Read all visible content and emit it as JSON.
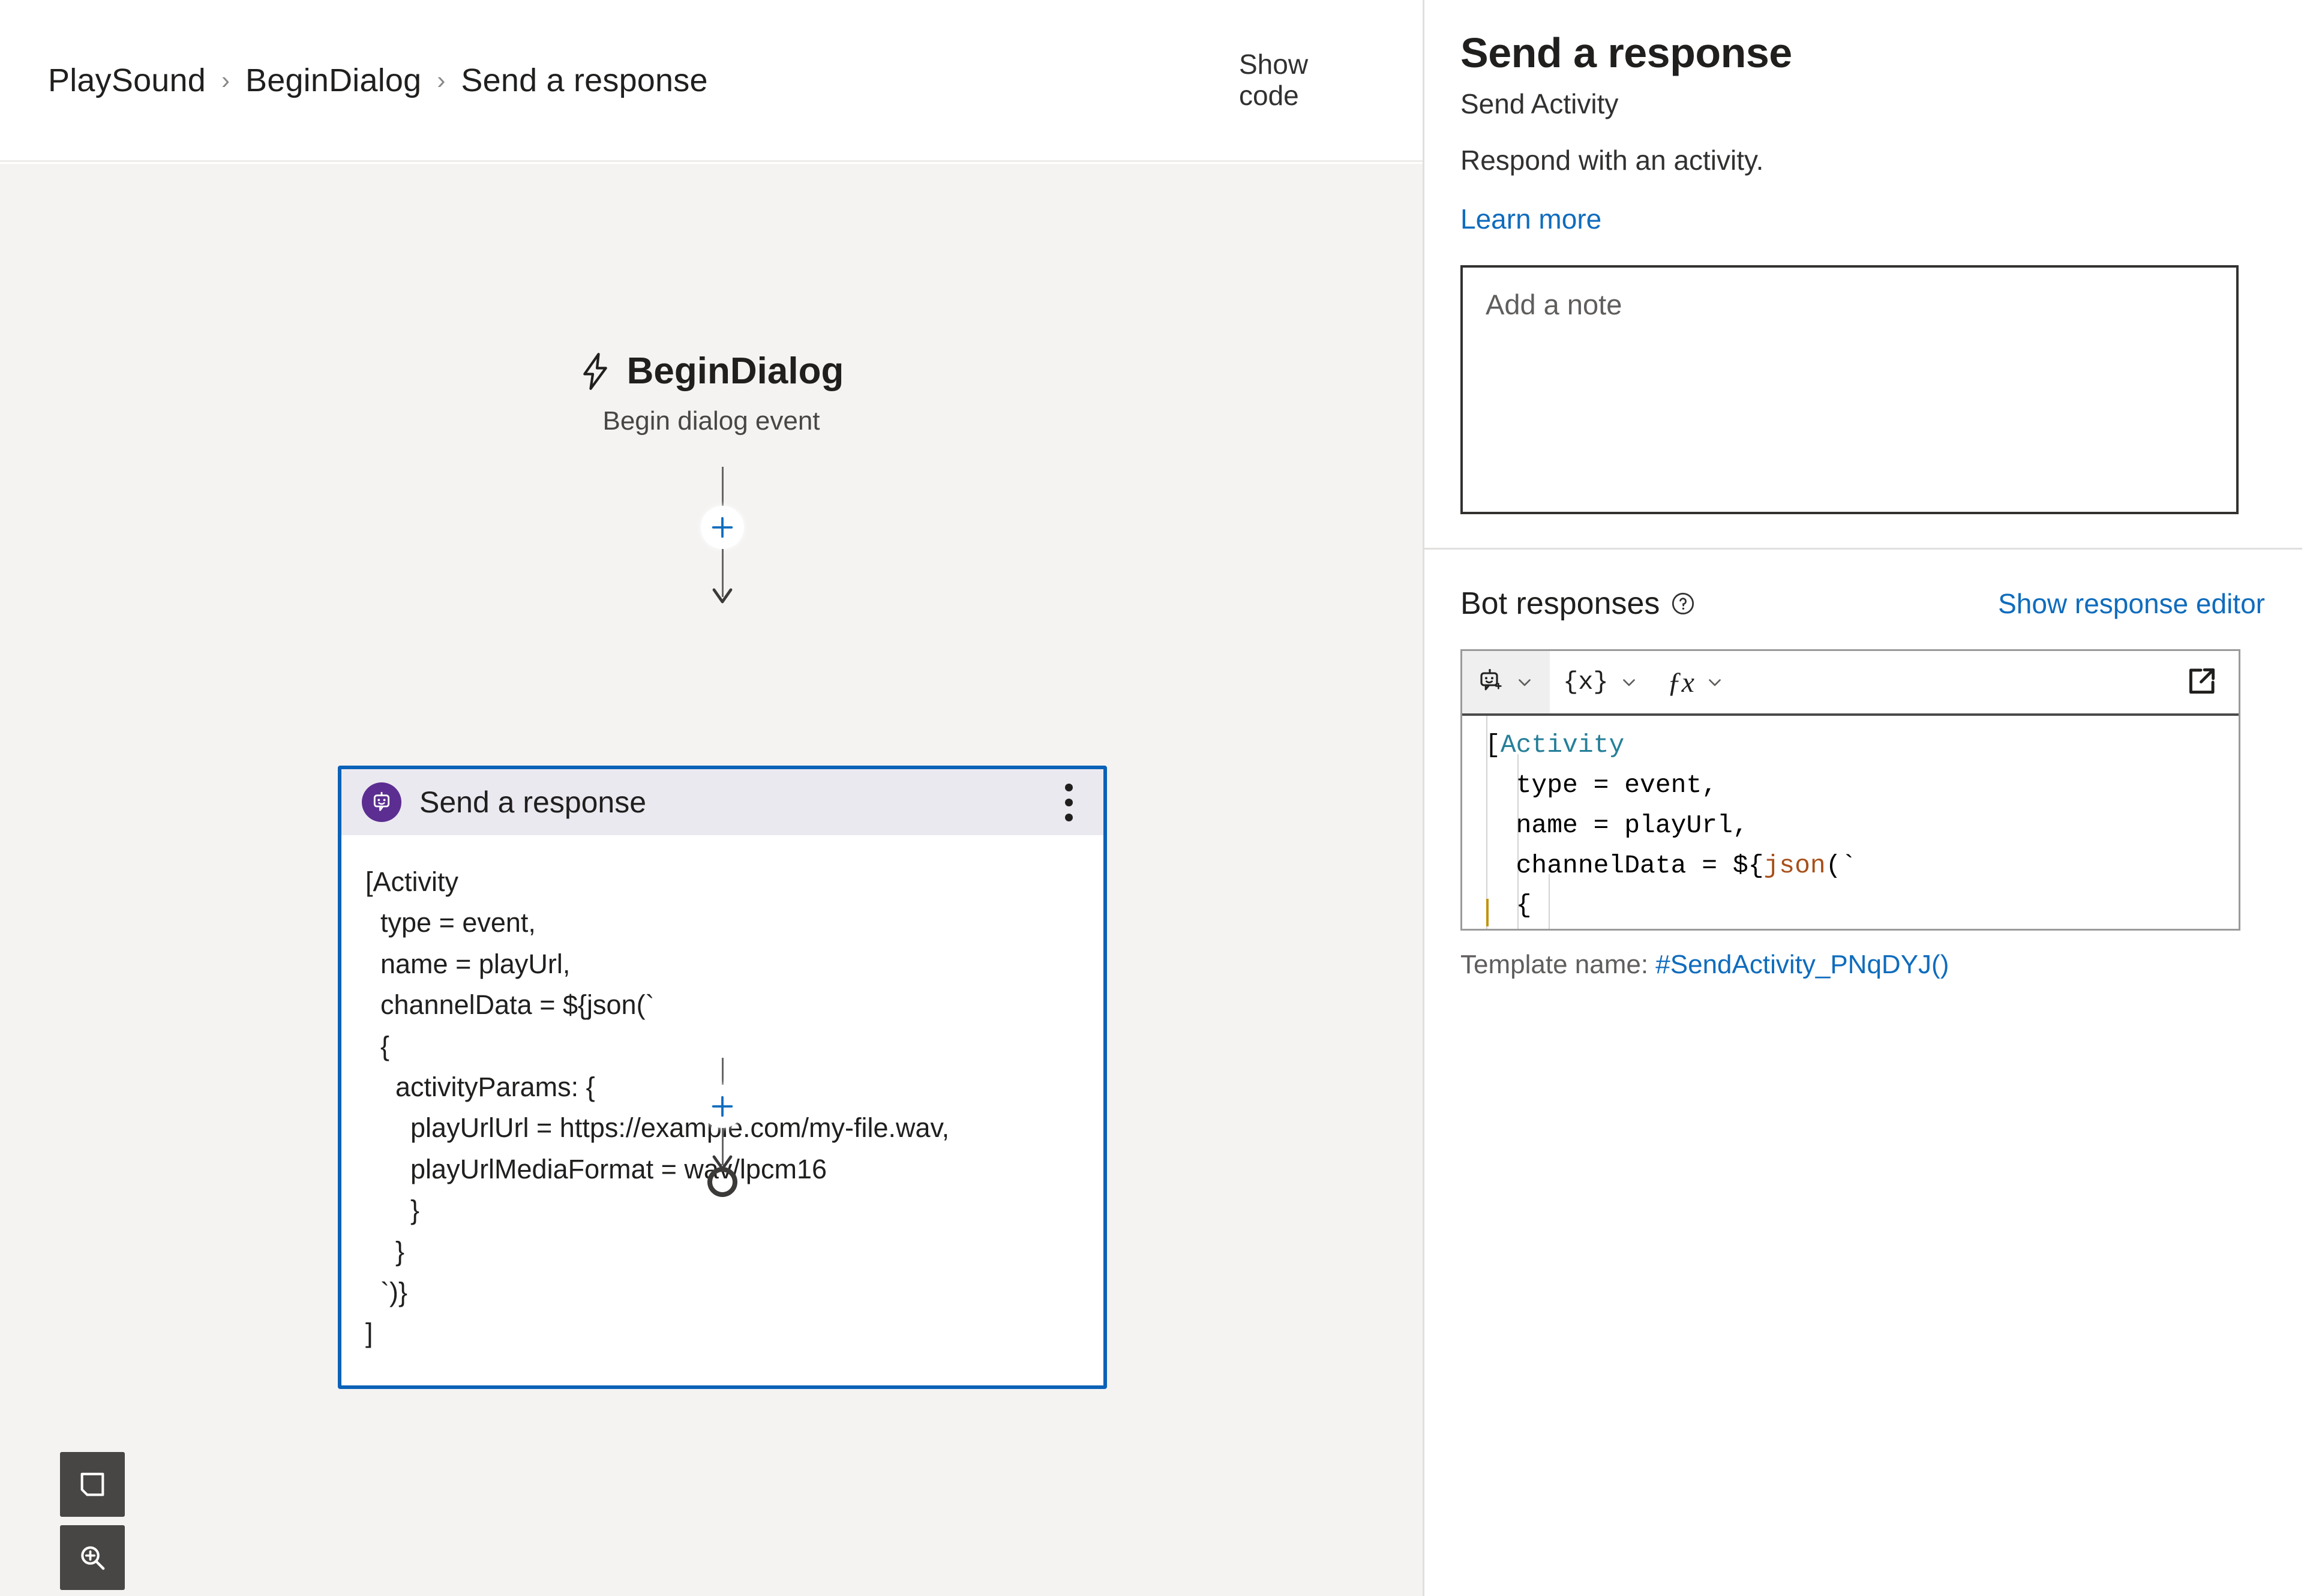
{
  "header": {
    "breadcrumb": [
      {
        "label": "PlaySound"
      },
      {
        "label": "BeginDialog"
      },
      {
        "label": "Send a response"
      }
    ],
    "separator": "›",
    "show_code_label": "Show\ncode"
  },
  "canvas": {
    "trigger": {
      "title": "BeginDialog",
      "subtitle": "Begin dialog event",
      "icon": "lightning-bolt-icon"
    },
    "node": {
      "icon": "bot-icon",
      "title": "Send a response",
      "menu_icon": "kebab-menu-icon",
      "body": "[Activity\n  type = event,\n  name = playUrl,\n  channelData = ${json(`\n  {\n    activityParams: {\n      playUrlUrl = https://example.com/my-file.wav,\n      playUrlMediaFormat = wav/lpcm16\n      }\n    }\n  `)}\n]"
    },
    "add_button_label": "+",
    "tools": [
      {
        "name": "fit-to-screen-button",
        "icon": "fit-to-screen-icon"
      },
      {
        "name": "zoom-in-button",
        "icon": "zoom-in-icon"
      }
    ]
  },
  "properties": {
    "title": "Send a response",
    "subtitle": "Send Activity",
    "description": "Respond with an activity.",
    "learn_more_label": "Learn more",
    "note_placeholder": "Add a note",
    "bot_responses": {
      "label": "Bot responses",
      "help_icon": "question-circle-icon",
      "show_editor_label": "Show response editor",
      "toolbar": {
        "bot_icon": "bot-response-icon",
        "variable_label": "{x}",
        "function_label": "ƒx",
        "popout_icon": "open-in-new-window-icon",
        "chevron_icon": "chevron-down-icon"
      },
      "code_lines": [
        {
          "indent": 0,
          "parts": [
            {
              "t": "[",
              "c": "plain"
            },
            {
              "t": "Activity",
              "c": "kw-type"
            }
          ]
        },
        {
          "indent": 1,
          "parts": [
            {
              "t": "type = event,",
              "c": "plain"
            }
          ]
        },
        {
          "indent": 1,
          "parts": [
            {
              "t": "name = playUrl,",
              "c": "plain"
            }
          ]
        },
        {
          "indent": 1,
          "parts": [
            {
              "t": "channelData = ${",
              "c": "plain"
            },
            {
              "t": "json",
              "c": "kw-fn"
            },
            {
              "t": "(`",
              "c": "plain"
            }
          ]
        },
        {
          "indent": 1,
          "parts": [
            {
              "t": "{",
              "c": "plain"
            }
          ]
        },
        {
          "indent": 2,
          "parts": [
            {
              "t": "activityParams: {",
              "c": "plain"
            }
          ]
        },
        {
          "indent": 3,
          "parts": [
            {
              "t": "playUrlUrl = https://example.com/",
              "c": "plain"
            }
          ]
        },
        {
          "indent": 3,
          "parts": [
            {
              "t": "playUrlMediaFormat = wav/lpcm16",
              "c": "plain"
            }
          ]
        },
        {
          "indent": 3,
          "parts": [
            {
              "t": "}",
              "c": "plain"
            }
          ]
        },
        {
          "indent": 2,
          "parts": [
            {
              "t": "}",
              "c": "plain"
            }
          ]
        },
        {
          "indent": 1,
          "parts": [
            {
              "t": "`)}",
              "c": "plain"
            }
          ]
        },
        {
          "indent": 0,
          "parts": [
            {
              "t": "]",
              "c": "plain"
            }
          ]
        }
      ],
      "template_name_label": "Template name: ",
      "template_name_value": "#SendActivity_PNqDYJ()"
    }
  },
  "colors": {
    "accent_blue": "#0f6cbd",
    "node_border": "#0b62b8",
    "node_header_bg": "#ebe9f0",
    "bot_badge": "#5c2e91",
    "canvas_bg": "#f4f3f2",
    "code_type": "#267f99",
    "code_function": "#a8501b"
  }
}
